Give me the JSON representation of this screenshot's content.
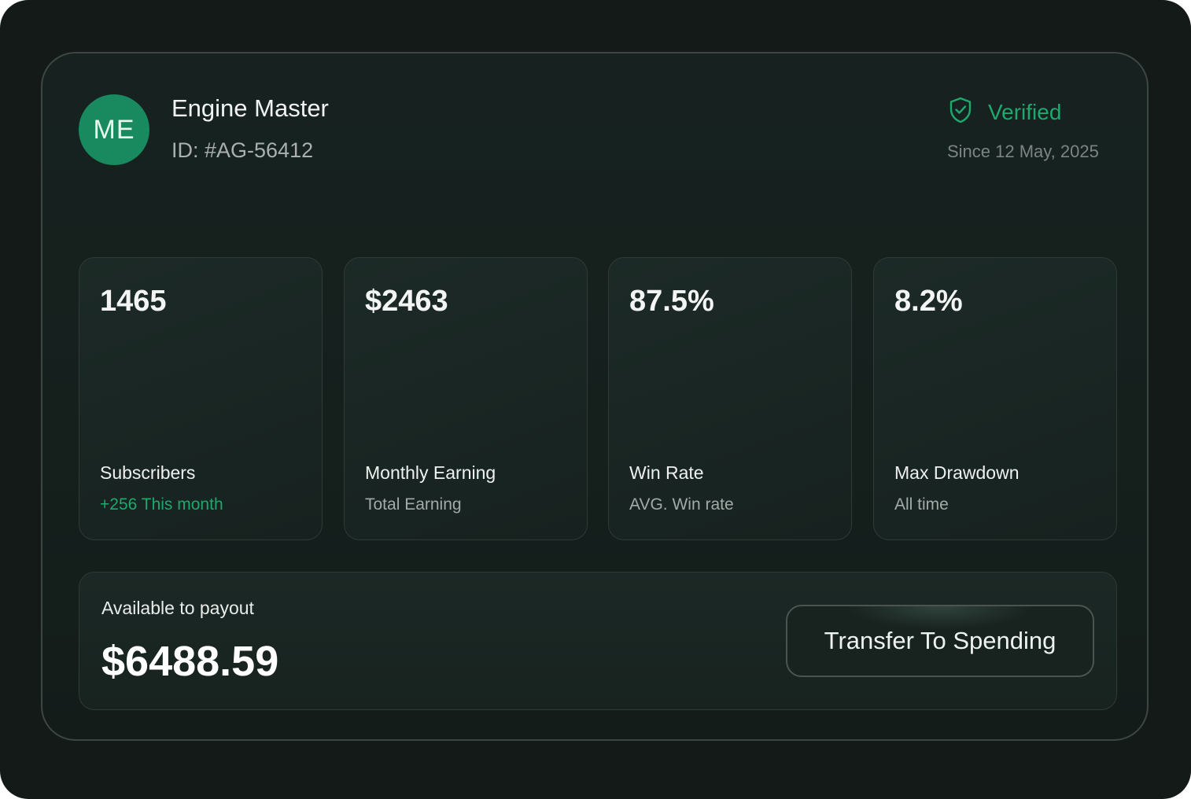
{
  "profile": {
    "initials": "ME",
    "name": "Engine Master",
    "id_text": "ID: #AG-56412",
    "avatar_color": "#198a5f"
  },
  "verification": {
    "icon": "shield-check-icon",
    "label": "Verified",
    "since": "Since 12 May, 2025",
    "color": "#1fa86e"
  },
  "stats": [
    {
      "value": "1465",
      "label": "Subscribers",
      "sub": "+256 This month"
    },
    {
      "value": "$2463",
      "label": "Monthly Earning",
      "sub": "Total Earning"
    },
    {
      "value": "87.5%",
      "label": "Win Rate",
      "sub": "AVG. Win rate"
    },
    {
      "value": "8.2%",
      "label": "Max Drawdown",
      "sub": "All time"
    }
  ],
  "payout": {
    "label": "Available to payout",
    "amount": "$6488.59",
    "button_label": "Transfer To Spending"
  }
}
